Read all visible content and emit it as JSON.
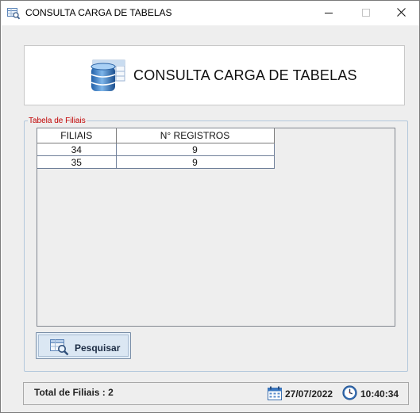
{
  "window": {
    "title": "CONSULTA CARGA DE TABELAS",
    "controls": [
      "minimize-icon",
      "maximize-icon",
      "close-icon"
    ]
  },
  "header": {
    "icon": "database-table-icon",
    "title": "CONSULTA CARGA DE TABELAS"
  },
  "filiais_group": {
    "legend": "Tabela de Filiais",
    "legend_color": "#c00000",
    "table": {
      "columns": [
        "FILIAIS",
        "N° REGISTROS"
      ],
      "rows": [
        [
          "34",
          "9"
        ],
        [
          "35",
          "9"
        ]
      ]
    }
  },
  "actions": {
    "search_label": "Pesquisar",
    "search_icon": "table-search-icon"
  },
  "status": {
    "total_label": "Total de Filiais :",
    "total_value": "2",
    "date": "27/07/2022",
    "time": "10:40:34",
    "date_icon": "calendar-icon",
    "time_icon": "clock-icon"
  }
}
